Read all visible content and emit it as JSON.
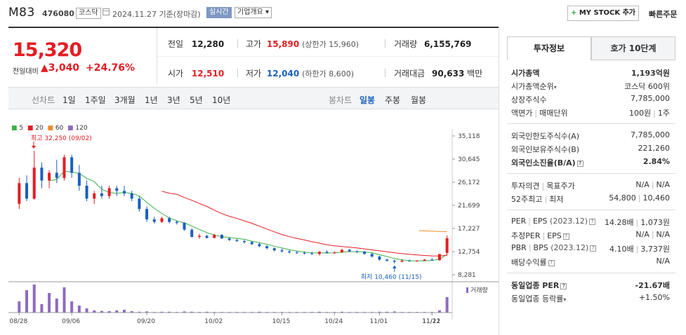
{
  "header": {
    "name": "M83",
    "code": "476080",
    "market": "코스닥",
    "date": "2024.11.27 기준(장마감)",
    "realtime": "실시간",
    "company": "기업개요 ▾",
    "mystock": "MY STOCK 추가",
    "mystock_plus": "+",
    "quick_order": "빠른주문"
  },
  "price": {
    "current": "15,320",
    "change_label": "전일대비",
    "change_abs": "▲3,040",
    "change_pct": "+24.76%"
  },
  "summary": {
    "prev_label": "전일",
    "prev": "12,280",
    "high_label": "고가",
    "high": "15,890",
    "upper_limit": "(상한가 15,960)",
    "volume_label": "거래량",
    "volume": "6,155,769",
    "open_label": "시가",
    "open": "12,510",
    "low_label": "저가",
    "low": "12,040",
    "lower_limit": "(하한가 8,600)",
    "amount_label": "거래대금",
    "amount": "90,633",
    "amount_unit": "백만"
  },
  "periods": {
    "line": "선차트",
    "items": [
      "1일",
      "1주일",
      "3개월",
      "1년",
      "3년",
      "5년",
      "10년"
    ],
    "candle": "봉차트",
    "candle_items": [
      "일봉",
      "주봉",
      "월봉"
    ],
    "active": "일봉"
  },
  "chart_data": {
    "type": "candlestick",
    "legend": [
      "5",
      "20",
      "60",
      "120"
    ],
    "legend_colors": [
      "#3cb043",
      "#e51c23",
      "#f08a24",
      "#8e6bbf"
    ],
    "y_ticks": [
      "35,118",
      "30,645",
      "26,172",
      "21,699",
      "17,227",
      "12,754",
      "8,281"
    ],
    "ylim": [
      8281,
      35118
    ],
    "x_ticks": [
      "08/28",
      "09/06",
      "09/20",
      "10/02",
      "10/15",
      "10/24",
      "11/01",
      "11/12",
      "11/21"
    ],
    "max_label": "최고 32,250 (09/02)",
    "min_label": "최저 10,460 (11/15)",
    "volume_label": "거래량",
    "candles": [
      [
        22000,
        27000,
        21000,
        26000
      ],
      [
        26000,
        27500,
        22500,
        23000
      ],
      [
        23000,
        32250,
        22800,
        29000
      ],
      [
        29000,
        30000,
        25000,
        26500
      ],
      [
        26500,
        28500,
        25000,
        28000
      ],
      [
        28000,
        30500,
        26000,
        27000
      ],
      [
        27000,
        31500,
        26500,
        31000
      ],
      [
        31000,
        31500,
        27000,
        28000
      ],
      [
        28000,
        29500,
        24500,
        25500
      ],
      [
        25500,
        26500,
        22500,
        23000
      ],
      [
        23000,
        24500,
        22000,
        24000
      ],
      [
        24000,
        25500,
        23000,
        23500
      ],
      [
        23500,
        25500,
        23000,
        25000
      ],
      [
        25000,
        25500,
        23500,
        24500
      ],
      [
        24500,
        25500,
        23500,
        24000
      ],
      [
        24000,
        24500,
        22500,
        23000
      ],
      [
        23000,
        23500,
        20500,
        21000
      ],
      [
        21000,
        21500,
        18500,
        19000
      ],
      [
        19000,
        19500,
        18200,
        18500
      ],
      [
        18500,
        19500,
        18300,
        19200
      ],
      [
        19200,
        19500,
        18200,
        18500
      ],
      [
        18500,
        18800,
        18000,
        18300
      ],
      [
        18300,
        18500,
        16800,
        17000
      ],
      [
        17000,
        17200,
        15500,
        15600
      ],
      [
        15600,
        16200,
        15200,
        15800
      ],
      [
        15800,
        16000,
        15300,
        15400
      ],
      [
        15400,
        16200,
        15300,
        16000
      ],
      [
        16000,
        16100,
        15200,
        15300
      ],
      [
        15300,
        15500,
        14800,
        15000
      ],
      [
        15000,
        15200,
        14600,
        14800
      ],
      [
        14800,
        15000,
        14300,
        14600
      ],
      [
        14600,
        14800,
        14000,
        14200
      ],
      [
        14200,
        14500,
        13600,
        13800
      ],
      [
        13800,
        14000,
        13200,
        13400
      ],
      [
        13400,
        13600,
        12800,
        13000
      ],
      [
        13000,
        13300,
        12600,
        12800
      ],
      [
        12800,
        13100,
        12400,
        12600
      ],
      [
        12600,
        12900,
        12300,
        12500
      ],
      [
        12500,
        12800,
        12200,
        12400
      ],
      [
        12400,
        12700,
        12100,
        12300
      ],
      [
        12300,
        12900,
        12000,
        12700
      ],
      [
        12700,
        13000,
        12400,
        12500
      ],
      [
        12500,
        12800,
        12300,
        12600
      ],
      [
        12600,
        13300,
        12500,
        13100
      ],
      [
        13100,
        13300,
        12700,
        12800
      ],
      [
        12800,
        13000,
        12500,
        12700
      ],
      [
        12700,
        12900,
        12200,
        12300
      ],
      [
        12300,
        12500,
        11600,
        11800
      ],
      [
        11800,
        12000,
        11000,
        11200
      ],
      [
        11200,
        11400,
        10800,
        11000
      ],
      [
        11000,
        11200,
        10460,
        10800
      ],
      [
        10800,
        11300,
        10700,
        11000
      ],
      [
        11000,
        11200,
        10800,
        10900
      ],
      [
        10900,
        11100,
        10800,
        11000
      ],
      [
        11000,
        11300,
        10900,
        11200
      ],
      [
        11200,
        11500,
        11000,
        11100
      ],
      [
        11100,
        12300,
        11000,
        12280
      ],
      [
        12510,
        15890,
        12040,
        15320
      ]
    ],
    "volumes": [
      40,
      80,
      100,
      30,
      70,
      50,
      90,
      40,
      25,
      15,
      8,
      6,
      5,
      8,
      10,
      5,
      3,
      4,
      2,
      3,
      3,
      2,
      4,
      3,
      2,
      3,
      2,
      2,
      2,
      2,
      2,
      2,
      3,
      2,
      2,
      2,
      2,
      2,
      2,
      2,
      3,
      2,
      2,
      3,
      2,
      2,
      2,
      2,
      3,
      3,
      4,
      2,
      2,
      2,
      2,
      2,
      8,
      55
    ]
  },
  "panel": {
    "tab1": "투자정보",
    "tab2": "호가 10단계",
    "market_cap_label": "시가총액",
    "market_cap": "1,193억원",
    "rank_label": "시가총액순위",
    "rank": "코스닥 600위",
    "shares_label": "상장주식수",
    "shares": "7,785,000",
    "par_label": "액면가",
    "unit_label": "매매단위",
    "par": "100원",
    "unit": "1주",
    "foreign_limit_label": "외국인한도주식수(A)",
    "foreign_limit": "7,785,000",
    "foreign_hold_label": "외국인보유주식수(B)",
    "foreign_hold": "221,260",
    "foreign_ratio_label": "외국인소진율(B/A)",
    "foreign_ratio": "2.84%",
    "opinion_label": "투자의견",
    "target_label": "목표주가",
    "opinion": "N/A",
    "target": "N/A",
    "w52_high_label": "52주최고",
    "w52_low_label": "최저",
    "w52_high": "54,800",
    "w52_low": "10,460",
    "per_label": "PER",
    "eps_label": "EPS",
    "eps_period": "(2023.12)",
    "per": "14.28배",
    "eps": "1,073원",
    "est_per_label": "추정PER",
    "est_eps_label": "EPS",
    "est_per": "N/A",
    "est_eps": "N/A",
    "pbr_label": "PBR",
    "bps_label": "BPS",
    "bps_period": "(2023.12)",
    "pbr": "4.10배",
    "bps": "3,737원",
    "dividend_label": "배당수익률",
    "dividend": "N/A",
    "industry_per_label": "동일업종 PER",
    "industry_per": "-21.67배",
    "industry_rate_label": "동일업종 등락률",
    "industry_rate": "+1.50%"
  }
}
